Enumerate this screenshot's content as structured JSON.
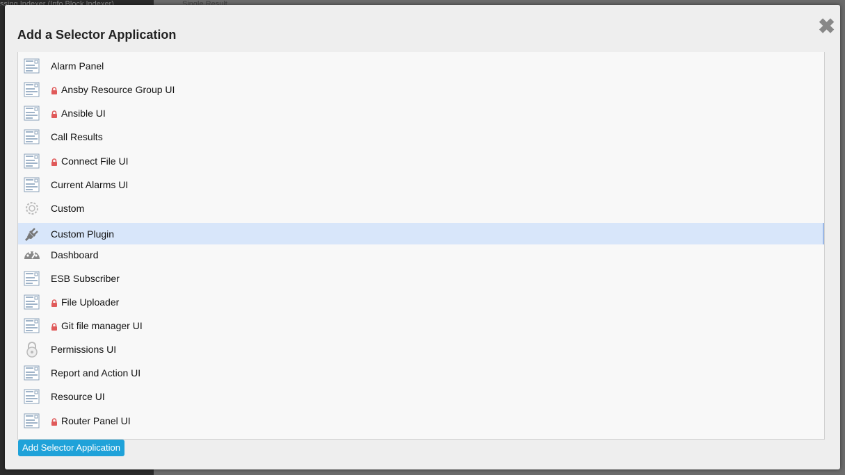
{
  "background": {
    "left_text": "ssing Indexer (Info Block Indexer)",
    "top_text": "Single Result"
  },
  "modal": {
    "title": "Add a Selector Application",
    "close_glyph": "✖",
    "submit_label": "Add Selector Application"
  },
  "items": [
    {
      "label": "Alarm Panel",
      "icon": "form-icon",
      "locked": false,
      "selected": false
    },
    {
      "label": "Ansby Resource Group UI",
      "icon": "form-icon",
      "locked": true,
      "selected": false
    },
    {
      "label": "Ansible UI",
      "icon": "form-icon",
      "locked": true,
      "selected": false
    },
    {
      "label": "Call Results",
      "icon": "form-icon",
      "locked": false,
      "selected": false
    },
    {
      "label": "Connect File UI",
      "icon": "form-icon",
      "locked": true,
      "selected": false
    },
    {
      "label": "Current Alarms UI",
      "icon": "form-icon",
      "locked": false,
      "selected": false
    },
    {
      "label": "Custom",
      "icon": "gear-icon",
      "locked": false,
      "selected": false
    },
    {
      "label": "Custom Plugin",
      "icon": "plug-icon",
      "locked": false,
      "selected": true
    },
    {
      "label": "Dashboard",
      "icon": "dashboard-icon",
      "locked": false,
      "selected": false
    },
    {
      "label": "ESB Subscriber",
      "icon": "form-icon",
      "locked": false,
      "selected": false
    },
    {
      "label": "File Uploader",
      "icon": "form-icon",
      "locked": true,
      "selected": false
    },
    {
      "label": "Git file manager UI",
      "icon": "form-icon",
      "locked": true,
      "selected": false
    },
    {
      "label": "Permissions UI",
      "icon": "padlock-icon",
      "locked": false,
      "selected": false
    },
    {
      "label": "Report and Action UI",
      "icon": "form-icon",
      "locked": false,
      "selected": false
    },
    {
      "label": "Resource UI",
      "icon": "form-icon",
      "locked": false,
      "selected": false
    },
    {
      "label": "Router Panel UI",
      "icon": "form-icon",
      "locked": true,
      "selected": false
    }
  ],
  "colors": {
    "selected_row": "#d8e6fa",
    "lock": "#e05a5a",
    "button": "#1fa2d9"
  }
}
